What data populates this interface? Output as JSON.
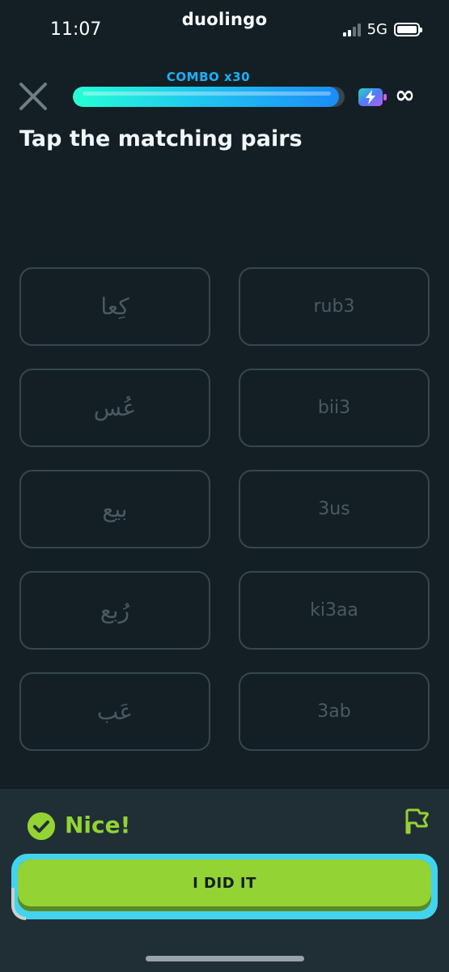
{
  "status_bar": {
    "time": "11:07",
    "app_name": "duolingo",
    "network": "5G"
  },
  "header": {
    "combo_label": "COMBO x30",
    "progress_fraction": 0.98,
    "hearts_value": "∞",
    "icons": [
      "close-icon",
      "energy-icon",
      "infinity-icon"
    ]
  },
  "prompt": "Tap the matching pairs",
  "tiles": {
    "left": [
      "كِعا",
      "عُس",
      "بيع",
      "رُبع",
      "عَب"
    ],
    "right": [
      "rub3",
      "bii3",
      "3us",
      "ki3aa",
      "3ab"
    ]
  },
  "footer": {
    "feedback": "Nice!",
    "continue_button": "I DID IT",
    "icons": [
      "check-circle-icon",
      "flag-icon"
    ]
  },
  "colors": {
    "background": "#131f24",
    "tile_border": "#37464f",
    "tile_text": "#4b5a62",
    "accent_green": "#93d333",
    "combo_blue": "#1cb0f6",
    "footer_bg": "#202f36"
  }
}
